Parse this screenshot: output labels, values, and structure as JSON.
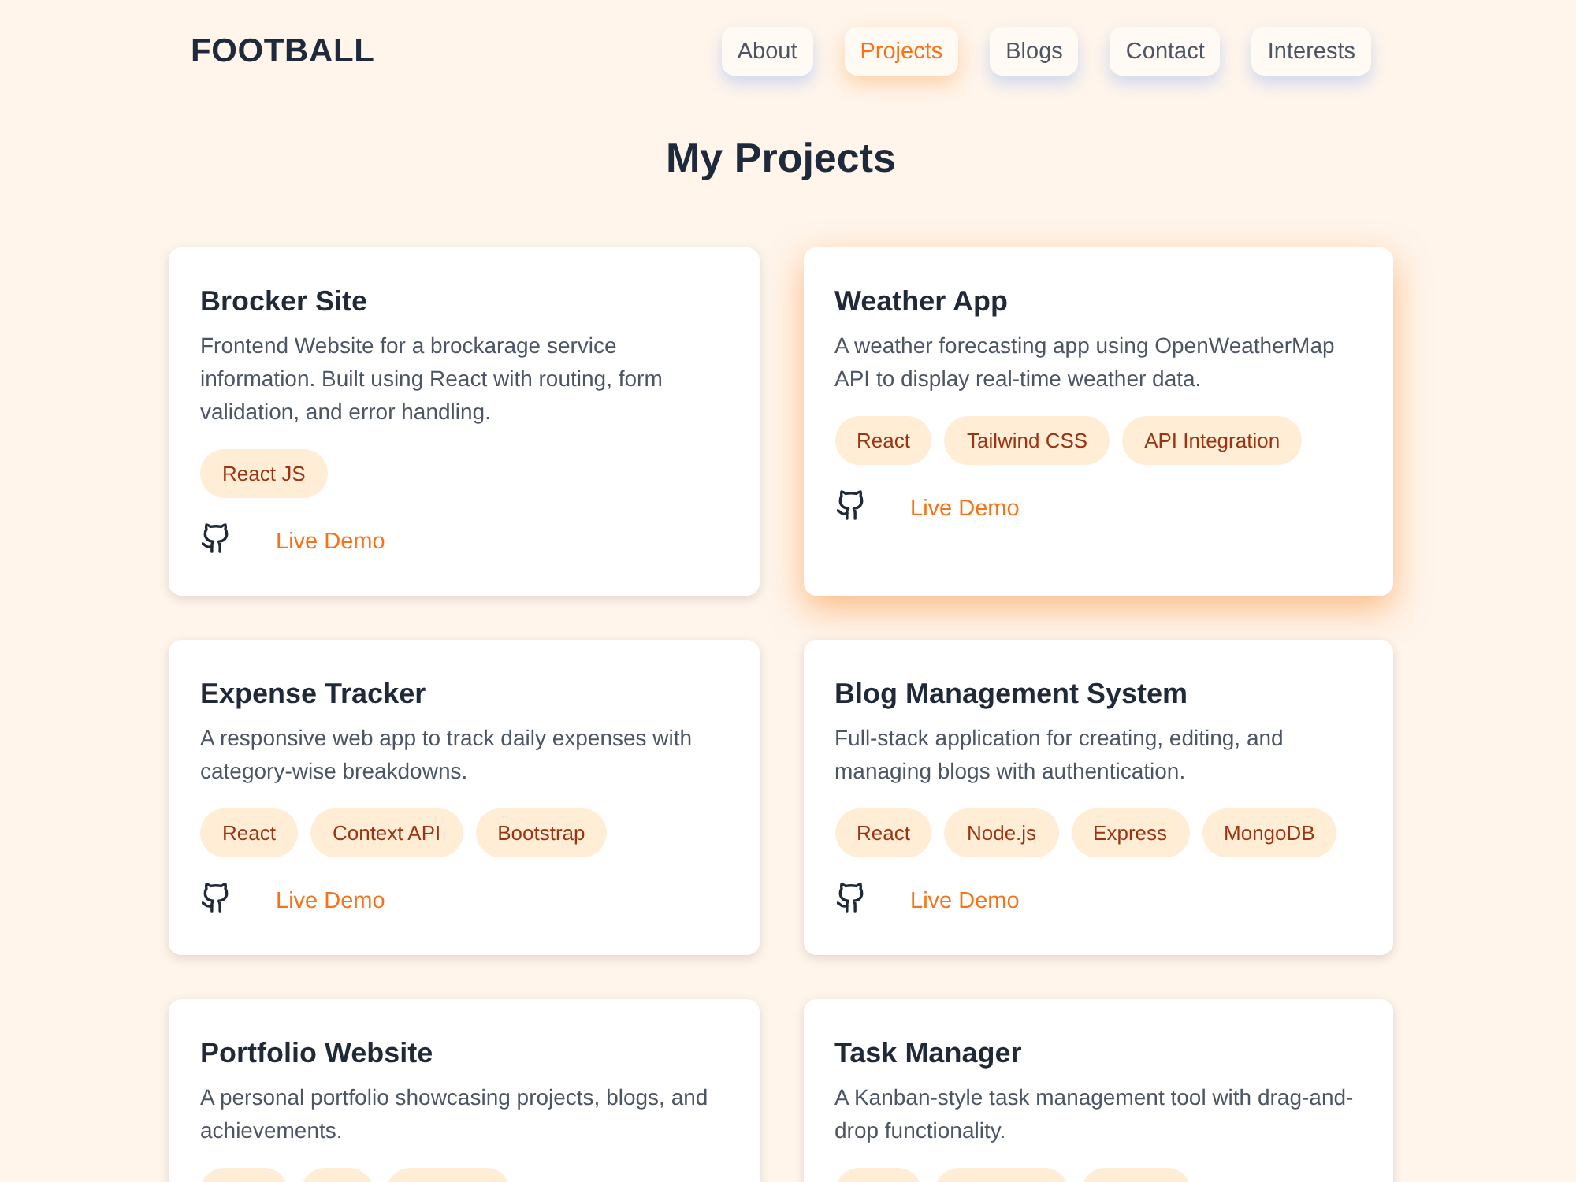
{
  "header": {
    "logo": "FOOTBALL",
    "nav": [
      {
        "label": "About",
        "selected": false
      },
      {
        "label": "Projects",
        "selected": true
      },
      {
        "label": "Blogs",
        "selected": false
      },
      {
        "label": "Contact",
        "selected": false
      },
      {
        "label": "Interests",
        "selected": false
      }
    ]
  },
  "title": "My Projects",
  "projects": [
    {
      "title": "Brocker Site",
      "description": "Frontend Website for a brockarage service information. Built using React with routing, form validation, and error handling.",
      "hovered": false,
      "tags": [
        {
          "kind": "pill",
          "label": "React JS"
        }
      ],
      "live_demo": "Live Demo"
    },
    {
      "title": "Weather App",
      "description": "A weather forecasting app using OpenWeatherMap API to display real-time weather data.",
      "hovered": true,
      "tags": [
        {
          "kind": "pill",
          "label": "React"
        },
        {
          "kind": "pill",
          "label": "Tailwind CSS"
        },
        {
          "kind": "pill",
          "label": "API Integration"
        }
      ],
      "live_demo": "Live Demo"
    },
    {
      "title": "Expense Tracker",
      "description": "A responsive web app to track daily expenses with category-wise breakdowns.",
      "hovered": false,
      "tags": [
        {
          "kind": "pill",
          "label": "React"
        },
        {
          "kind": "pill",
          "label": "Context API"
        },
        {
          "kind": "pill",
          "label": "Bootstrap"
        }
      ],
      "live_demo": "Live Demo"
    },
    {
      "title": "Blog Management System",
      "description": "Full-stack application for creating, editing, and managing blogs with authentication.",
      "hovered": false,
      "tags": [
        {
          "kind": "pill",
          "label": "React"
        },
        {
          "kind": "pill",
          "label": "Node.js"
        },
        {
          "kind": "pill",
          "label": "Express"
        },
        {
          "kind": "pill",
          "label": "MongoDB"
        }
      ],
      "live_demo": "Live Demo"
    },
    {
      "title": "Portfolio Website",
      "description": "A personal portfolio showcasing projects, blogs, and achievements.",
      "hovered": false,
      "tags": [
        {
          "kind": "cut_off"
        },
        {
          "kind": "cut_off"
        },
        {
          "kind": "cut_off"
        }
      ]
    },
    {
      "title": "Task Manager",
      "description": "A Kanban-style task management tool with drag-and-drop functionality.",
      "hovered": false,
      "tags": [
        {
          "kind": "cut_off"
        },
        {
          "kind": "cut_off"
        },
        {
          "kind": "cut_off"
        }
      ]
    }
  ]
}
